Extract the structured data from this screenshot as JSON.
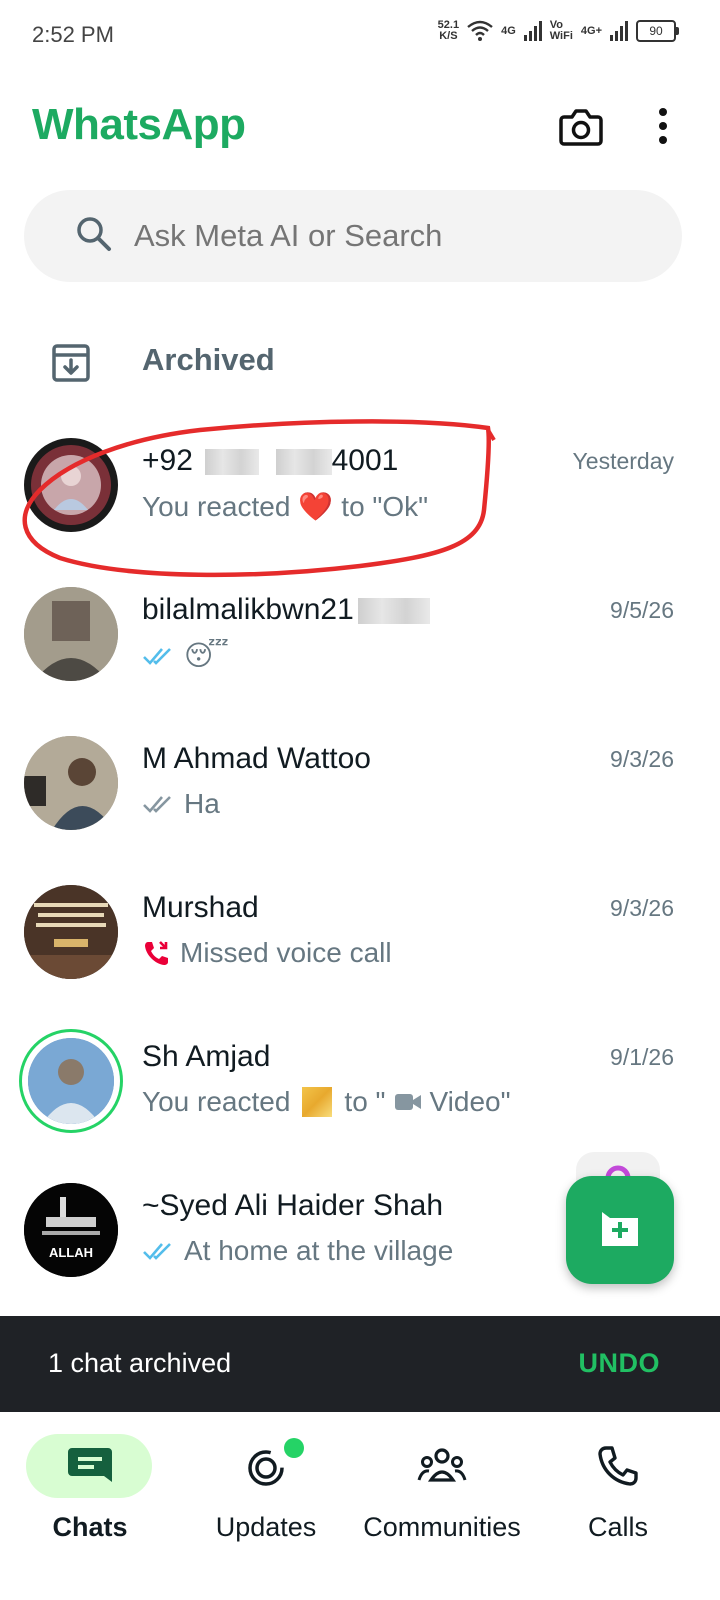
{
  "status_bar": {
    "time": "2:52 PM",
    "net_speed_value": "52.1",
    "net_speed_unit": "K/S",
    "sim1_label": "4G",
    "volte_label": "Vo\nWiFi",
    "sim2_label": "4G+",
    "battery": "90"
  },
  "header": {
    "title": "WhatsApp",
    "camera_icon": "camera-icon",
    "menu_icon": "more-vert-icon"
  },
  "search": {
    "placeholder": "Ask Meta AI or Search"
  },
  "archived": {
    "label": "Archived"
  },
  "chats": [
    {
      "name_prefix": "+92",
      "name_suffix": "4001",
      "time": "Yesterday",
      "preview_before": "You reacted",
      "reaction": "❤️",
      "preview_after": "to \"Ok\""
    },
    {
      "name": "bilalmalikbwn21",
      "time": "9/5/26",
      "preview": "😴",
      "read_status": "read"
    },
    {
      "name": "M Ahmad Wattoo",
      "time": "9/3/26",
      "preview": "Ha",
      "read_status": "delivered"
    },
    {
      "name": "Murshad",
      "time": "9/3/26",
      "preview": "Missed voice call",
      "call_icon": "missed-call-icon"
    },
    {
      "name": "Sh Amjad",
      "time": "9/1/26",
      "preview_before": "You reacted",
      "preview_after": "to \"",
      "media_label": "Video\"",
      "media_icon": "video-icon"
    },
    {
      "name": "~Syed Ali Haider Shah",
      "time": "",
      "preview": "At home at the village",
      "read_status": "read",
      "avatar_text": "ALLAH"
    }
  ],
  "snackbar": {
    "message": "1 chat archived",
    "action": "UNDO"
  },
  "bottom_nav": {
    "items": [
      {
        "label": "Chats",
        "icon": "chats-icon",
        "active": true
      },
      {
        "label": "Updates",
        "icon": "updates-icon",
        "badge": true
      },
      {
        "label": "Communities",
        "icon": "communities-icon"
      },
      {
        "label": "Calls",
        "icon": "calls-icon"
      }
    ]
  },
  "colors": {
    "brand": "#1daa61",
    "read_ticks": "#53bdeb",
    "missed_call": "#ea0038",
    "annotation": "#e52b2b"
  }
}
